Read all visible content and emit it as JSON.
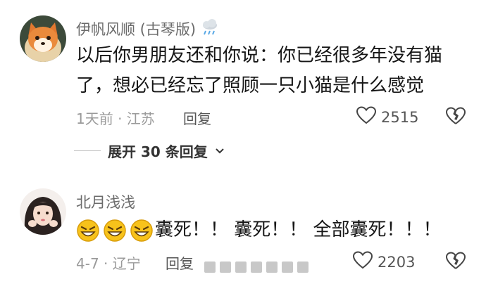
{
  "comments": [
    {
      "username": "伊帆风顺 (古琴版)",
      "badge_icon": "rain-cloud-icon",
      "text_line1": "以后你男朋友还和你说：你已经很多年没有猫",
      "text_line2": "了，想必已经忘了照顾一只小猫是什么感觉",
      "meta": "1天前 · 江苏",
      "reply_label": "回复",
      "like_count": "2515",
      "expand_label": "展开 30 条回复"
    },
    {
      "username": "北月浅浅",
      "emoji_icon": "grinning-squint-emoji",
      "text": "囊死！！ 囊死！！ 全部囊死！！！",
      "meta": "4-7 · 辽宁",
      "reply_label": "回复",
      "like_count": "2203"
    }
  ],
  "colors": {
    "meta_gray": "#9a9a9a",
    "username_gray": "#6b6b6b",
    "emoji_yellow": "#f7c21b"
  }
}
